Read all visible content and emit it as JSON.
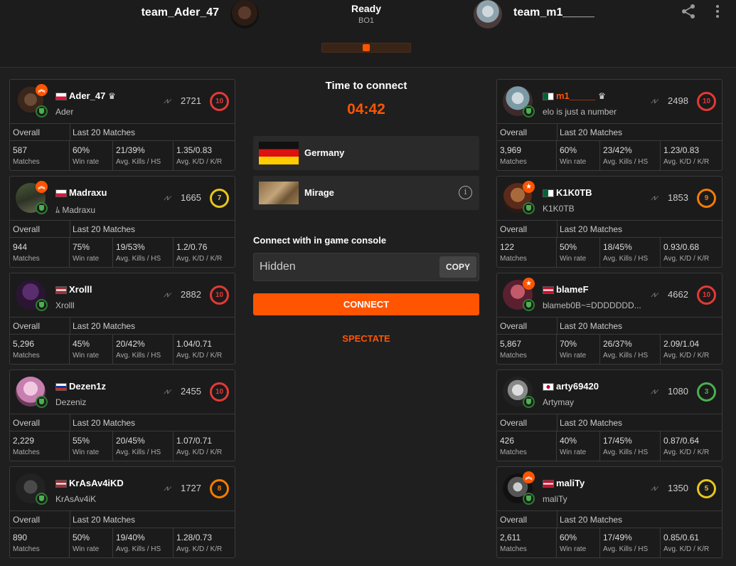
{
  "header": {
    "team_left": "team_Ader_47",
    "team_right": "team_m1_____",
    "status": "Ready",
    "format": "BO1",
    "share_icon": "share-icon",
    "more_icon": "more-vertical-icon"
  },
  "middle": {
    "time_label": "Time to connect",
    "timer": "04:42",
    "location": "Germany",
    "map": "Mirage",
    "console_label": "Connect with in game console",
    "console_value": "Hidden",
    "copy_label": "COPY",
    "connect_label": "CONNECT",
    "spectate_label": "SPECTATE"
  },
  "stat_labels": {
    "overall": "Overall",
    "last20": "Last 20 Matches",
    "matches": "Matches",
    "winrate": "Win rate",
    "kills_hs": "Avg. Kills / HS",
    "kd_kr": "Avg. K/D / K/R"
  },
  "left_players": [
    {
      "name": "Ader_47",
      "sub": "Ader",
      "elo": "2721",
      "level": "10",
      "matches": "587",
      "winrate": "60%",
      "kills_hs": "21/39%",
      "kd_kr": "1.35/0.83",
      "crown": "♛",
      "badge": "chevron"
    },
    {
      "name": "Madraxu",
      "sub": "ﾑ Madraxu",
      "elo": "1665",
      "level": "7",
      "matches": "944",
      "winrate": "75%",
      "kills_hs": "19/53%",
      "kd_kr": "1.2/0.76",
      "badge": "chevron"
    },
    {
      "name": "Xrolll",
      "sub": "Xrolll",
      "elo": "2882",
      "level": "10",
      "matches": "5,296",
      "winrate": "45%",
      "kills_hs": "20/42%",
      "kd_kr": "1.04/0.71"
    },
    {
      "name": "Dezen1z",
      "sub": "Dezeniz",
      "elo": "2455",
      "level": "10",
      "matches": "2,229",
      "winrate": "55%",
      "kills_hs": "20/45%",
      "kd_kr": "1.07/0.71"
    },
    {
      "name": "KrAsAv4iKD",
      "sub": "KrAsAv4iK",
      "elo": "1727",
      "level": "8",
      "matches": "890",
      "winrate": "50%",
      "kills_hs": "19/40%",
      "kd_kr": "1.28/0.73"
    }
  ],
  "right_players": [
    {
      "name": "m1_____",
      "sub": "elo is just a number",
      "elo": "2498",
      "level": "10",
      "matches": "3,969",
      "winrate": "60%",
      "kills_hs": "23/42%",
      "kd_kr": "1.23/0.83",
      "crown": "♛"
    },
    {
      "name": "K1K0TB",
      "sub": "K1K0TB",
      "elo": "1853",
      "level": "9",
      "matches": "122",
      "winrate": "50%",
      "kills_hs": "18/45%",
      "kd_kr": "0.93/0.68",
      "badge": "star"
    },
    {
      "name": "blameF",
      "sub": "blameb0B~=DDDDDDD...",
      "elo": "4662",
      "level": "10",
      "matches": "5,867",
      "winrate": "70%",
      "kills_hs": "26/37%",
      "kd_kr": "2.09/1.04",
      "badge": "star"
    },
    {
      "name": "arty69420",
      "sub": "Artymay",
      "elo": "1080",
      "level": "3",
      "matches": "426",
      "winrate": "40%",
      "kills_hs": "17/45%",
      "kd_kr": "0.87/0.64"
    },
    {
      "name": "maliTy",
      "sub": "maliTy",
      "elo": "1350",
      "level": "5",
      "matches": "2,611",
      "winrate": "60%",
      "kills_hs": "17/49%",
      "kd_kr": "0.85/0.61",
      "badge": "chevron"
    }
  ],
  "colors": {
    "accent": "#ff5500",
    "background": "#1f1f1f",
    "card_border": "#3a3a3a",
    "level_red": "#e53935",
    "level_yellow": "#e8c61a",
    "level_orange": "#f57c00",
    "level_green": "#4caf50"
  }
}
